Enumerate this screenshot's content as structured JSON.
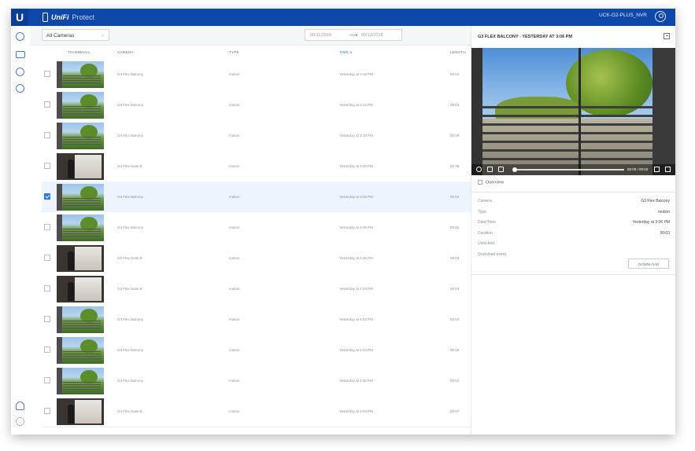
{
  "app": {
    "logo_letter": "U",
    "brand_primary": "UniFi",
    "brand_secondary": "Protect",
    "nvr_name": "UCK-G2-PLUS_NVR",
    "accent_color": "#0d47a8"
  },
  "sidebar": {
    "icons": [
      "dashboard-icon",
      "cameras-icon",
      "play-icon",
      "search-icon",
      "users-icon",
      "settings-icon"
    ]
  },
  "toolbar": {
    "camera_filter": "All Cameras",
    "date_from": "09/11/2018",
    "date_to": "09/13/2018"
  },
  "table": {
    "columns": {
      "thumbnail": "THUMBNAIL",
      "camera": "CAMERA",
      "type": "TYPE",
      "time": "TIME ∧",
      "length": "LENGTH"
    },
    "rows": [
      {
        "camera": "G3 Flex Balcony",
        "type": "motion",
        "time": "Yesterday at 3:18 PM",
        "length": "00:04",
        "thumb": "balcony",
        "selected": false
      },
      {
        "camera": "G3 Flex Balcony",
        "type": "motion",
        "time": "Yesterday at 3:12 PM",
        "length": "00:03",
        "thumb": "balcony",
        "selected": false
      },
      {
        "camera": "G3 Flex Balcony",
        "type": "motion",
        "time": "Yesterday at 3:10 PM",
        "length": "00:05",
        "thumb": "balcony",
        "selected": false
      },
      {
        "camera": "G3 Flex Suite B",
        "type": "motion",
        "time": "Yesterday at 3:09 PM",
        "length": "00:08",
        "thumb": "suite",
        "selected": false
      },
      {
        "camera": "G3 Flex Balcony",
        "type": "motion",
        "time": "Yesterday at 3:06 PM",
        "length": "00:03",
        "thumb": "balcony",
        "selected": true
      },
      {
        "camera": "G3 Flex Balcony",
        "type": "motion",
        "time": "Yesterday at 4:09 PM",
        "length": "00:05",
        "thumb": "balcony",
        "selected": false
      },
      {
        "camera": "G3 Flex Suite B",
        "type": "motion",
        "time": "Yesterday at 4:05 PM",
        "length": "00:03",
        "thumb": "suite",
        "selected": false
      },
      {
        "camera": "G3 Flex Suite B",
        "type": "motion",
        "time": "Yesterday at 4:04 PM",
        "length": "00:04",
        "thumb": "suite",
        "selected": false
      },
      {
        "camera": "G3 Flex Balcony",
        "type": "motion",
        "time": "Yesterday at 4:03 PM",
        "length": "00:04",
        "thumb": "balcony",
        "selected": false
      },
      {
        "camera": "G3 Flex Balcony",
        "type": "motion",
        "time": "Yesterday at 4:03 PM",
        "length": "00:06",
        "thumb": "balcony",
        "selected": false
      },
      {
        "camera": "G3 Flex Balcony",
        "type": "motion",
        "time": "Yesterday at 4:25 PM",
        "length": "00:04",
        "thumb": "balcony",
        "selected": false
      },
      {
        "camera": "G3 Flex Suite B",
        "type": "motion",
        "time": "Yesterday at 4:03 PM",
        "length": "00:07",
        "thumb": "suite",
        "selected": false
      }
    ]
  },
  "detail": {
    "title": "G3 FLEX BALCONY - YESTERDAY AT 3:06 PM",
    "video_time": "00:00 / 00:03",
    "overview_label": "Overview",
    "fields": [
      {
        "key": "Camera",
        "value": "G3 Flex Balcony"
      },
      {
        "key": "Type",
        "value": "motion"
      },
      {
        "key": "Date/Time",
        "value": "Yesterday at 3:06 PM"
      },
      {
        "key": "Duration",
        "value": "00:03"
      },
      {
        "key": "Unlocked",
        "value": ""
      },
      {
        "key": "Download event",
        "value": ""
      }
    ],
    "download_label": "DOWNLOAD"
  }
}
